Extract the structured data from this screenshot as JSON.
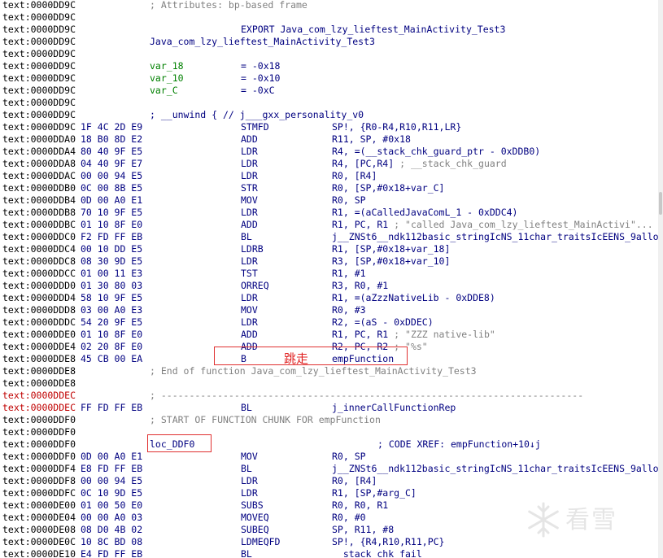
{
  "listing": {
    "rows": [
      {
        "seg": "text:0000DD9C",
        "a": "; Attributes: bp-based frame",
        "a_cls": "gray"
      },
      {
        "seg": "text:0000DD9C"
      },
      {
        "seg": "text:0000DD9C",
        "mn": "EXPORT Java_com_lzy_lieftest_MainActivity_Test3"
      },
      {
        "seg": "text:0000DD9C",
        "a": "Java_com_lzy_lieftest_MainActivity_Test3",
        "a_cls": "navy"
      },
      {
        "seg": "text:0000DD9C"
      },
      {
        "seg": "text:0000DD9C",
        "a": "var_18",
        "a_cls": "green",
        "mn": "= -0x18"
      },
      {
        "seg": "text:0000DD9C",
        "a": "var_10",
        "a_cls": "green",
        "mn": "= -0x10"
      },
      {
        "seg": "text:0000DD9C",
        "a": "var_C",
        "a_cls": "green",
        "mn": "= -0xC"
      },
      {
        "seg": "text:0000DD9C"
      },
      {
        "seg": "text:0000DD9C",
        "a": "; __unwind { // j___gxx_personality_v0",
        "a_cls": "navy"
      },
      {
        "seg": "text:0000DD9C",
        "bytes": "1F 4C 2D E9",
        "mn": "STMFD",
        "op": "SP!, {R0-R4,R10,R11,LR}"
      },
      {
        "seg": "text:0000DDA0",
        "bytes": "18 B0 8D E2",
        "mn": "ADD",
        "op": "R11, SP, #0x18"
      },
      {
        "seg": "text:0000DDA4",
        "bytes": "80 40 9F E5",
        "mn": "LDR",
        "op": "R4, =(__stack_chk_guard_ptr - 0xDDB0)"
      },
      {
        "seg": "text:0000DDA8",
        "bytes": "04 40 9F E7",
        "mn": "LDR",
        "op": "R4, [PC,R4]",
        "cm": " ; __stack_chk_guard"
      },
      {
        "seg": "text:0000DDAC",
        "bytes": "00 00 94 E5",
        "mn": "LDR",
        "op": "R0, [R4]"
      },
      {
        "seg": "text:0000DDB0",
        "bytes": "0C 00 8B E5",
        "mn": "STR",
        "op": "R0, [SP,#0x18+var_C]"
      },
      {
        "seg": "text:0000DDB4",
        "bytes": "0D 00 A0 E1",
        "mn": "MOV",
        "op": "R0, SP"
      },
      {
        "seg": "text:0000DDB8",
        "bytes": "70 10 9F E5",
        "mn": "LDR",
        "op": "R1, =(aCalledJavaComL_1 - 0xDDC4)"
      },
      {
        "seg": "text:0000DDBC",
        "bytes": "01 10 8F E0",
        "mn": "ADD",
        "op": "R1, PC, R1",
        "cm": " ; \"called Java_com_lzy_lieftest_MainActivi\"..."
      },
      {
        "seg": "text:0000DDC0",
        "bytes": "F2 FD FF EB",
        "mn": "BL",
        "op": "j__ZNSt6__ndk112basic_stringIcNS_11char_traitsIcEENS_9allo"
      },
      {
        "seg": "text:0000DDC4",
        "bytes": "00 10 DD E5",
        "mn": "LDRB",
        "op": "R1, [SP,#0x18+var_18]"
      },
      {
        "seg": "text:0000DDC8",
        "bytes": "08 30 9D E5",
        "mn": "LDR",
        "op": "R3, [SP,#0x18+var_10]"
      },
      {
        "seg": "text:0000DDCC",
        "bytes": "01 00 11 E3",
        "mn": "TST",
        "op": "R1, #1"
      },
      {
        "seg": "text:0000DDD0",
        "bytes": "01 30 80 03",
        "mn": "ORREQ",
        "op": "R3, R0, #1"
      },
      {
        "seg": "text:0000DDD4",
        "bytes": "58 10 9F E5",
        "mn": "LDR",
        "op": "R1, =(aZzzNativeLib - 0xDDE8)"
      },
      {
        "seg": "text:0000DDD8",
        "bytes": "03 00 A0 E3",
        "mn": "MOV",
        "op": "R0, #3"
      },
      {
        "seg": "text:0000DDDC",
        "bytes": "54 20 9F E5",
        "mn": "LDR",
        "op": "R2, =(aS - 0xDDEC)"
      },
      {
        "seg": "text:0000DDE0",
        "bytes": "01 10 8F E0",
        "mn": "ADD",
        "op": "R1, PC, R1",
        "cm": " ; \"ZZZ native-lib\""
      },
      {
        "seg": "text:0000DDE4",
        "bytes": "02 20 8F E0",
        "mn": "ADD",
        "op": "R2, PC, R2",
        "cm": " ; \"%s\""
      },
      {
        "seg": "text:0000DDE8",
        "bytes": "45 CB 00 EA",
        "mn": "B",
        "op": "empFunction"
      },
      {
        "seg": "text:0000DDE8",
        "a": "; End of function Java_com_lzy_lieftest_MainActivity_Test3",
        "a_cls": "gray"
      },
      {
        "seg": "text:0000DDE8"
      },
      {
        "seg": "text:0000DDEC",
        "seg_red": true,
        "a": "; ---------------------------------------------------------------------------",
        "a_cls": "gray"
      },
      {
        "seg": "text:0000DDEC",
        "seg_red": true,
        "bytes": "FF FD FF EB",
        "mn": "BL",
        "op": "j_innerCallFunctionRep"
      },
      {
        "seg": "text:0000DDF0",
        "a": "; START OF FUNCTION CHUNK FOR empFunction",
        "a_cls": "gray"
      },
      {
        "seg": "text:0000DDF0"
      },
      {
        "seg": "text:0000DDF0",
        "a": "loc_DDF0",
        "a_cls": "navy",
        "xref": "; CODE XREF: empFunction+10↓j"
      },
      {
        "seg": "text:0000DDF0",
        "bytes": "0D 00 A0 E1",
        "mn": "MOV",
        "op": "R0, SP"
      },
      {
        "seg": "text:0000DDF4",
        "bytes": "E8 FD FF EB",
        "mn": "BL",
        "op": "j__ZNSt6__ndk112basic_stringIcNS_11char_traitsIcEENS_9allo"
      },
      {
        "seg": "text:0000DDF8",
        "bytes": "00 00 94 E5",
        "mn": "LDR",
        "op": "R0, [R4]"
      },
      {
        "seg": "text:0000DDFC",
        "bytes": "0C 10 9D E5",
        "mn": "LDR",
        "op": "R1, [SP,#arg_C]"
      },
      {
        "seg": "text:0000DE00",
        "bytes": "01 00 50 E0",
        "mn": "SUBS",
        "op": "R0, R0, R1"
      },
      {
        "seg": "text:0000DE04",
        "bytes": "00 00 A0 03",
        "mn": "MOVEQ",
        "op": "R0, #0"
      },
      {
        "seg": "text:0000DE08",
        "bytes": "08 D0 4B 02",
        "mn": "SUBEQ",
        "op": "SP, R11, #8"
      },
      {
        "seg": "text:0000DE0C",
        "bytes": "10 8C BD 08",
        "mn": "LDMEQFD",
        "op": "SP!, {R4,R10,R11,PC}"
      },
      {
        "seg": "text:0000DE10",
        "bytes": "E4 FD FF EB",
        "mn": "BL",
        "op": "  stack chk fail"
      }
    ]
  },
  "annotation": {
    "label": "跳走"
  },
  "watermark": {
    "text": "看雪"
  }
}
